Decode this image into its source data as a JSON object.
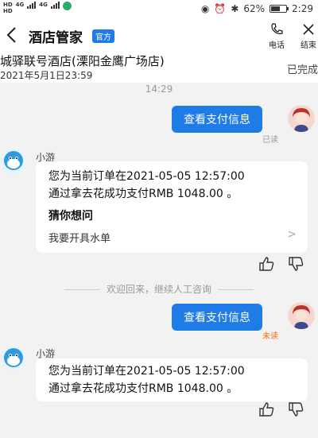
{
  "status_bar": {
    "sim1_top": "HD",
    "sim1_bottom": "HD",
    "net1": "4G",
    "net2": "4G",
    "battery": "62%",
    "battery_level": 0.62,
    "time": "2:29"
  },
  "header": {
    "title": "酒店管家",
    "badge": "官方",
    "phone_label": "电话",
    "end_label": "结束"
  },
  "order": {
    "hotel_name": "城驿联号酒店(溧阳金鹰广场店)",
    "order_time": "2021年5月1日23:59",
    "status": "已完成"
  },
  "chat": {
    "timestamp": "14:29",
    "sent1": {
      "text": "查看支付信息",
      "status": "已读"
    },
    "bot1": {
      "name": "小游",
      "line1": "您为当前订单在2021-05-05 12:57:00",
      "line2": "通过拿去花成功支付RMB 1048.00 。",
      "guess_title": "猜你想问",
      "guess_item": "我要开具水单",
      "guess_arrow": ">"
    },
    "system_message": "欢迎回来，继续人工咨询",
    "sent2": {
      "text": "查看支付信息",
      "status": "未读"
    },
    "bot2": {
      "name": "小游",
      "line1": "您为当前订单在2021-05-05 12:57:00",
      "line2": "通过拿去花成功支付RMB 1048.00 。"
    }
  },
  "colors": {
    "accent": "#1f7be6",
    "unread": "#ff6a00",
    "background": "#f2f2f2"
  }
}
